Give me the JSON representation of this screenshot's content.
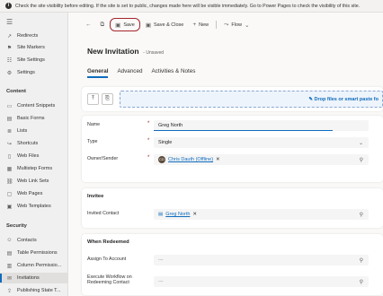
{
  "banner": {
    "text": "Check the site visibility before editing. If the site is set to public, changes made here will be visible immediately. Go to Power Pages to check the visibility of this site."
  },
  "sidebar": {
    "items_top": [
      {
        "label": "Redirects",
        "icon": "redirect-icon"
      },
      {
        "label": "Site Markers",
        "icon": "marker-icon"
      },
      {
        "label": "Site Settings",
        "icon": "settings-list-icon"
      },
      {
        "label": "Settings",
        "icon": "gear-icon"
      }
    ],
    "content_heading": "Content",
    "content_items": [
      {
        "label": "Content Snippets",
        "icon": "snippet-icon"
      },
      {
        "label": "Basic Forms",
        "icon": "form-icon"
      },
      {
        "label": "Lists",
        "icon": "list-icon"
      },
      {
        "label": "Shortcuts",
        "icon": "shortcut-icon"
      },
      {
        "label": "Web Files",
        "icon": "file-icon"
      },
      {
        "label": "Multistep Forms",
        "icon": "multistep-icon"
      },
      {
        "label": "Web Link Sets",
        "icon": "link-icon"
      },
      {
        "label": "Web Pages",
        "icon": "page-icon"
      },
      {
        "label": "Web Templates",
        "icon": "template-icon"
      }
    ],
    "security_heading": "Security",
    "security_items": [
      {
        "label": "Contacts",
        "icon": "person-icon"
      },
      {
        "label": "Table Permissions",
        "icon": "table-lock-icon"
      },
      {
        "label": "Column Permissio...",
        "icon": "column-lock-icon"
      },
      {
        "label": "Invitations",
        "icon": "invitation-icon"
      },
      {
        "label": "Publishing State T...",
        "icon": "publish-icon"
      }
    ]
  },
  "toolbar": {
    "save": "Save",
    "save_close": "Save & Close",
    "new": "New",
    "flow": "Flow"
  },
  "header": {
    "title": "New Invitation",
    "status": "- Unsaved"
  },
  "tabs": [
    "General",
    "Advanced",
    "Activities & Notes"
  ],
  "dropzone": {
    "text": "Drop files or smart paste fo"
  },
  "fields": {
    "name": {
      "label": "Name",
      "value": "Greg North"
    },
    "type": {
      "label": "Type",
      "value": "Single"
    },
    "owner": {
      "label": "Owner/Sender",
      "value": "Chris Dauth (Offline)",
      "avatar": "CD"
    }
  },
  "invitee": {
    "title": "Invitee",
    "contact_label": "Invited Contact",
    "contact_value": "Greg North"
  },
  "redeemed": {
    "title": "When Redeemed",
    "assign_label": "Assign To Account",
    "assign_value": "---",
    "workflow_label_1": "Execute Workflow on",
    "workflow_label_2": "Redeeming Contact",
    "workflow_value": "---"
  }
}
